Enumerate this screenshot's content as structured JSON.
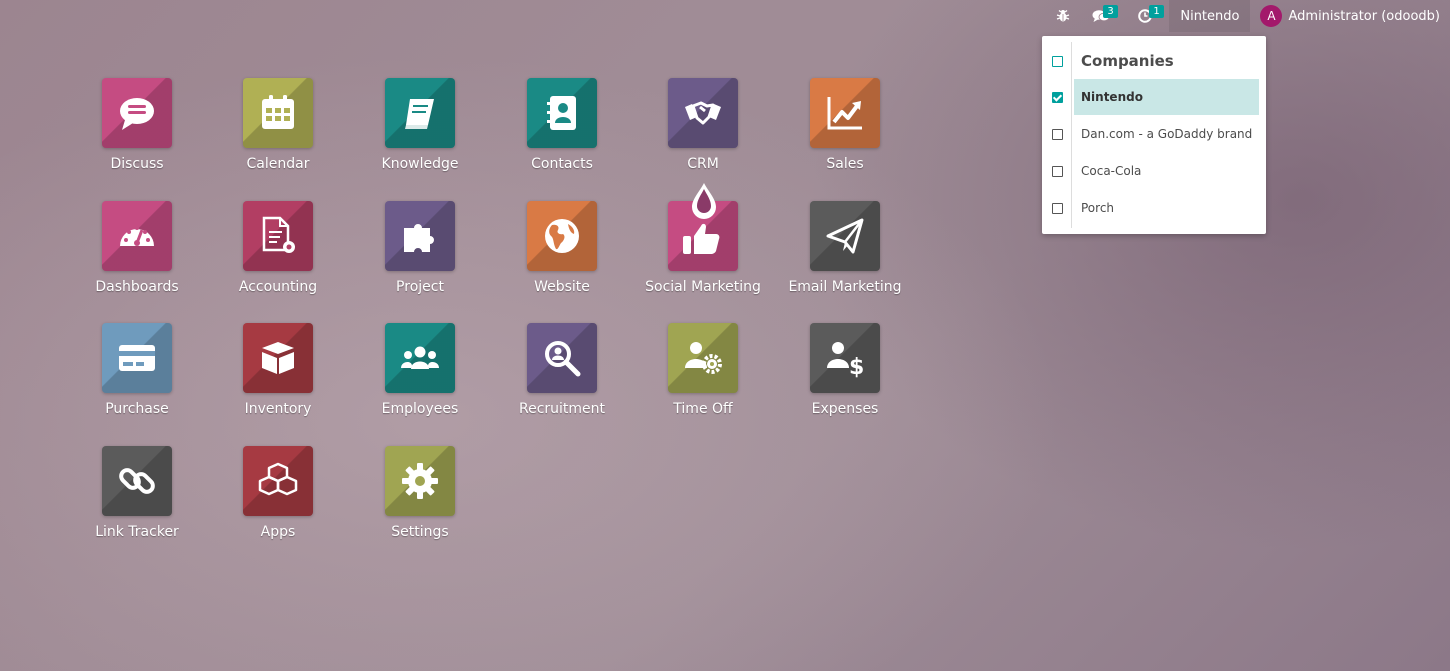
{
  "navbar": {
    "discuss_count": "3",
    "activity_count": "1",
    "current_company": "Nintendo",
    "user_initial": "A",
    "user_name": "Administrator (odoodb)"
  },
  "company_menu": {
    "title": "Companies",
    "items": [
      {
        "label": "Nintendo",
        "checked": true
      },
      {
        "label": "Dan.com - a GoDaddy brand",
        "checked": false
      },
      {
        "label": "Coca-Cola",
        "checked": false
      },
      {
        "label": "Porch",
        "checked": false
      }
    ]
  },
  "apps": [
    {
      "label": "Discuss",
      "icon": "chat-bubble-icon",
      "color": "#c54c82"
    },
    {
      "label": "Calendar",
      "icon": "calendar-icon",
      "color": "#b0b054"
    },
    {
      "label": "Knowledge",
      "icon": "book-icon",
      "color": "#1a8a85"
    },
    {
      "label": "Contacts",
      "icon": "address-book-icon",
      "color": "#1a8a85"
    },
    {
      "label": "CRM",
      "icon": "handshake-icon",
      "color": "#6c5b8a"
    },
    {
      "label": "Sales",
      "icon": "trend-chart-icon",
      "color": "#d97a45"
    },
    {
      "label": "Dashboards",
      "icon": "speedometer-icon",
      "color": "#c54c82"
    },
    {
      "label": "Accounting",
      "icon": "document-gear-icon",
      "color": "#b23e63"
    },
    {
      "label": "Project",
      "icon": "puzzle-icon",
      "color": "#6c5b8a"
    },
    {
      "label": "Website",
      "icon": "globe-icon",
      "color": "#d97a45"
    },
    {
      "label": "Social Marketing",
      "icon": "thumbs-up-icon",
      "color": "#c54c82"
    },
    {
      "label": "Email Marketing",
      "icon": "paper-plane-icon",
      "color": "#5b5b5b"
    },
    {
      "label": "Purchase",
      "icon": "credit-card-icon",
      "color": "#6f9bbd"
    },
    {
      "label": "Inventory",
      "icon": "open-box-icon",
      "color": "#a63a42"
    },
    {
      "label": "Employees",
      "icon": "people-icon",
      "color": "#1a8a85"
    },
    {
      "label": "Recruitment",
      "icon": "magnifier-icon",
      "color": "#6c5b8a"
    },
    {
      "label": "Time Off",
      "icon": "person-gear-icon",
      "color": "#a0a552"
    },
    {
      "label": "Expenses",
      "icon": "person-dollar-icon",
      "color": "#5b5b5b"
    },
    {
      "label": "Link Tracker",
      "icon": "chain-link-icon",
      "color": "#5b5b5b"
    },
    {
      "label": "Apps",
      "icon": "cubes-icon",
      "color": "#a63a42"
    },
    {
      "label": "Settings",
      "icon": "gear-icon",
      "color": "#a0a552"
    }
  ]
}
